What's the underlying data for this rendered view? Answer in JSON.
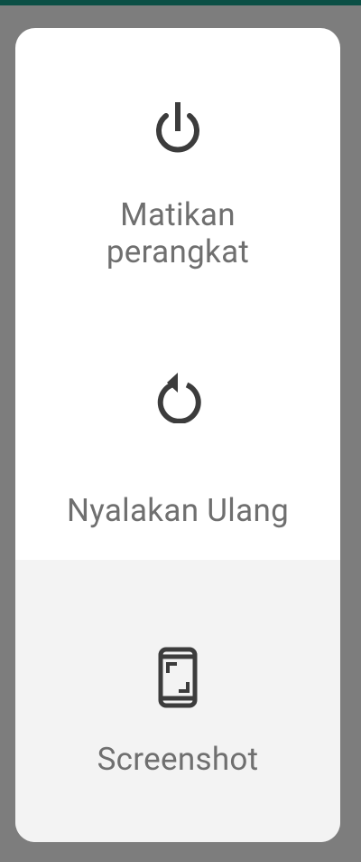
{
  "background_color": "#7d7d7d",
  "status_strip_color": "#0b4f45",
  "menu": {
    "items": [
      {
        "id": "power-off",
        "icon": "power-icon",
        "label_line1": "Matikan",
        "label_line2": "perangkat",
        "background": "#ffffff"
      },
      {
        "id": "restart",
        "icon": "restart-icon",
        "label": "Nyalakan Ulang",
        "background": "#ffffff"
      },
      {
        "id": "screenshot",
        "icon": "screenshot-icon",
        "label": "Screenshot",
        "background": "#f3f3f3"
      }
    ],
    "icon_color": "#3c3c3c",
    "label_color": "#6f6f6f"
  }
}
